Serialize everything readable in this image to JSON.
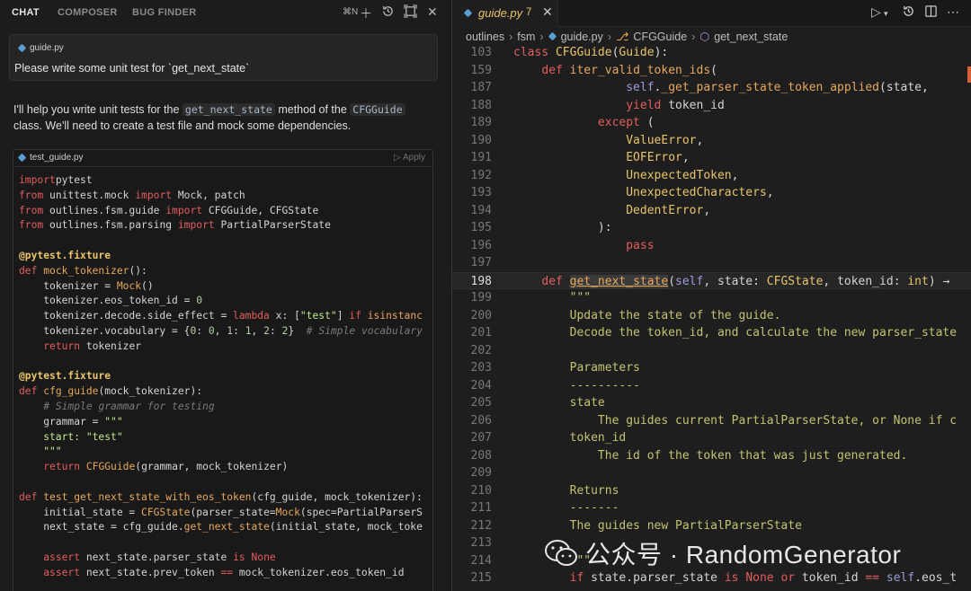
{
  "chat": {
    "tabs": [
      "CHAT",
      "COMPOSER",
      "BUG FINDER"
    ],
    "shortcut": "⌘N",
    "question": {
      "file_pill": "guide.py",
      "text": "Please write some unit test for `get_next_state`"
    },
    "answer": {
      "p1": "I'll help you write unit tests for the",
      "code1": "get_next_state",
      "p2": "method of the",
      "code2": "CFGGuide",
      "p3": "class. We'll need to create a test file and mock some dependencies."
    },
    "code_block": {
      "filename": "test_guide.py",
      "apply_label": "Apply"
    },
    "code_lines": [
      [
        [
          "k-red",
          "import"
        ],
        [
          "",
          "pytest"
        ]
      ],
      [
        [
          "k-red",
          "from"
        ],
        [
          "",
          " unittest.mock "
        ],
        [
          "k-red",
          "import"
        ],
        [
          "",
          " Mock, patch"
        ]
      ],
      [
        [
          "k-red",
          "from"
        ],
        [
          "",
          " outlines.fsm.guide "
        ],
        [
          "k-red",
          "import"
        ],
        [
          "",
          " CFGGuide, CFGState"
        ]
      ],
      [
        [
          "k-red",
          "from"
        ],
        [
          "",
          " outlines.fsm.parsing "
        ],
        [
          "k-red",
          "import"
        ],
        [
          "",
          " PartialParserState"
        ]
      ],
      [],
      [
        [
          "k-dec",
          "@pytest.fixture"
        ]
      ],
      [
        [
          "k-red",
          "def"
        ],
        [
          "",
          " "
        ],
        [
          "k-fn",
          "mock_tokenizer"
        ],
        [
          "",
          "():"
        ]
      ],
      [
        [
          "",
          "    tokenizer = "
        ],
        [
          "k-fn",
          "Mock"
        ],
        [
          "",
          "()"
        ]
      ],
      [
        [
          "",
          "    tokenizer.eos_token_id = "
        ],
        [
          "k-num",
          "0"
        ]
      ],
      [
        [
          "",
          "    tokenizer.decode.side_effect = "
        ],
        [
          "k-red",
          "lambda"
        ],
        [
          "",
          " x: ["
        ],
        [
          "k-str",
          "\"test\""
        ],
        [
          "",
          "] "
        ],
        [
          "k-red",
          "if"
        ],
        [
          "",
          " "
        ],
        [
          "k-fn",
          "isinstanc"
        ]
      ],
      [
        [
          "",
          "    tokenizer.vocabulary = {"
        ],
        [
          "k-num",
          "0"
        ],
        [
          "",
          ": "
        ],
        [
          "k-num",
          "0"
        ],
        [
          "",
          ", "
        ],
        [
          "k-num",
          "1"
        ],
        [
          "",
          ": "
        ],
        [
          "k-num",
          "1"
        ],
        [
          "",
          ", "
        ],
        [
          "k-num",
          "2"
        ],
        [
          "",
          ": "
        ],
        [
          "k-num",
          "2"
        ],
        [
          "",
          "}  "
        ],
        [
          "k-cm",
          "# Simple vocabulary"
        ]
      ],
      [
        [
          "",
          "    "
        ],
        [
          "k-red",
          "return"
        ],
        [
          "",
          " tokenizer"
        ]
      ],
      [],
      [
        [
          "k-dec",
          "@pytest.fixture"
        ]
      ],
      [
        [
          "k-red",
          "def"
        ],
        [
          "",
          " "
        ],
        [
          "k-fn",
          "cfg_guide"
        ],
        [
          "",
          "(mock_tokenizer):"
        ]
      ],
      [
        [
          "",
          "    "
        ],
        [
          "k-cm",
          "# Simple grammar for testing"
        ]
      ],
      [
        [
          "",
          "    grammar = "
        ],
        [
          "k-str",
          "\"\"\""
        ]
      ],
      [
        [
          "k-str",
          "    start: \"test\""
        ]
      ],
      [
        [
          "k-str",
          "    \"\"\""
        ]
      ],
      [
        [
          "",
          "    "
        ],
        [
          "k-red",
          "return"
        ],
        [
          "",
          " "
        ],
        [
          "k-fn",
          "CFGGuide"
        ],
        [
          "",
          "(grammar, mock_tokenizer)"
        ]
      ],
      [],
      [
        [
          "k-red",
          "def"
        ],
        [
          "",
          " "
        ],
        [
          "k-fn",
          "test_get_next_state_with_eos_token"
        ],
        [
          "",
          "(cfg_guide, mock_tokenizer):"
        ]
      ],
      [
        [
          "",
          "    initial_state = "
        ],
        [
          "k-fn",
          "CFGState"
        ],
        [
          "",
          "(parser_state="
        ],
        [
          "k-fn",
          "Mock"
        ],
        [
          "",
          "(spec=PartialParserS"
        ]
      ],
      [
        [
          "",
          "    next_state = cfg_guide."
        ],
        [
          "k-fn",
          "get_next_state"
        ],
        [
          "",
          "(initial_state, mock_toke"
        ]
      ],
      [],
      [
        [
          "",
          "    "
        ],
        [
          "k-red",
          "assert"
        ],
        [
          "",
          " next_state.parser_state "
        ],
        [
          "k-red",
          "is"
        ],
        [
          "",
          " "
        ],
        [
          "k-red",
          "None"
        ]
      ],
      [
        [
          "",
          "    "
        ],
        [
          "k-red",
          "assert"
        ],
        [
          "",
          " next_state.prev_token "
        ],
        [
          "k-red",
          "=="
        ],
        [
          "",
          " mock_tokenizer.eos_token_id"
        ]
      ]
    ]
  },
  "editor": {
    "tab": {
      "filename": "guide.py",
      "badge": "7"
    },
    "breadcrumbs": [
      "outlines",
      "fsm",
      "guide.py",
      "CFGGuide",
      "get_next_state"
    ],
    "lines": [
      {
        "n": "103",
        "t": [
          [
            "k-red",
            "class"
          ],
          [
            "",
            " "
          ],
          [
            "k-cls",
            "CFGGuide"
          ],
          [
            "",
            "("
          ],
          [
            "k-cls",
            "Guide"
          ],
          [
            "",
            "):"
          ]
        ]
      },
      {
        "n": "159",
        "t": [
          [
            "",
            "    "
          ],
          [
            "k-red",
            "def"
          ],
          [
            "",
            " "
          ],
          [
            "k-fn",
            "iter_valid_token_ids"
          ],
          [
            "",
            "("
          ]
        ]
      },
      {
        "n": "187",
        "t": [
          [
            "",
            "                "
          ],
          [
            "k-self",
            "self"
          ],
          [
            "",
            "."
          ],
          [
            "k-fn",
            "_get_parser_state_token_applied"
          ],
          [
            "",
            "(state, "
          ]
        ]
      },
      {
        "n": "188",
        "t": [
          [
            "",
            "                "
          ],
          [
            "k-red",
            "yield"
          ],
          [
            "",
            " token_id"
          ]
        ]
      },
      {
        "n": "189",
        "t": [
          [
            "",
            "            "
          ],
          [
            "k-red",
            "except"
          ],
          [
            "",
            " ("
          ]
        ]
      },
      {
        "n": "190",
        "t": [
          [
            "",
            "                "
          ],
          [
            "k-cls",
            "ValueError"
          ],
          [
            "",
            ","
          ]
        ]
      },
      {
        "n": "191",
        "t": [
          [
            "",
            "                "
          ],
          [
            "k-cls",
            "EOFError"
          ],
          [
            "",
            ","
          ]
        ]
      },
      {
        "n": "192",
        "t": [
          [
            "",
            "                "
          ],
          [
            "k-cls",
            "UnexpectedToken"
          ],
          [
            "",
            ","
          ]
        ]
      },
      {
        "n": "193",
        "t": [
          [
            "",
            "                "
          ],
          [
            "k-cls",
            "UnexpectedCharacters"
          ],
          [
            "",
            ","
          ]
        ]
      },
      {
        "n": "194",
        "t": [
          [
            "",
            "                "
          ],
          [
            "k-cls",
            "DedentError"
          ],
          [
            "",
            ","
          ]
        ]
      },
      {
        "n": "195",
        "t": [
          [
            "",
            "            ):"
          ]
        ]
      },
      {
        "n": "196",
        "t": [
          [
            "",
            "                "
          ],
          [
            "k-red",
            "pass"
          ]
        ]
      },
      {
        "n": "197",
        "t": []
      },
      {
        "n": "198",
        "cur": true,
        "t": [
          [
            "",
            "    "
          ],
          [
            "k-red",
            "def"
          ],
          [
            "",
            " "
          ],
          [
            "k-fn k-hl",
            "get_next_state"
          ],
          [
            "",
            "("
          ],
          [
            "k-self",
            "self"
          ],
          [
            "",
            ", state: "
          ],
          [
            "k-cls",
            "CFGState"
          ],
          [
            "",
            ", token_id: "
          ],
          [
            "k-cls",
            "int"
          ],
          [
            "",
            ") →"
          ]
        ]
      },
      {
        "n": "199",
        "t": [
          [
            "k-doc",
            "        \"\"\""
          ]
        ]
      },
      {
        "n": "200",
        "t": [
          [
            "k-doc",
            "        Update the state of the guide."
          ]
        ]
      },
      {
        "n": "201",
        "t": [
          [
            "k-doc",
            "        Decode the token_id, and calculate the new parser_state"
          ]
        ]
      },
      {
        "n": "202",
        "t": []
      },
      {
        "n": "203",
        "t": [
          [
            "k-doc",
            "        Parameters"
          ]
        ]
      },
      {
        "n": "204",
        "t": [
          [
            "k-doc",
            "        ----------"
          ]
        ]
      },
      {
        "n": "205",
        "t": [
          [
            "k-doc",
            "        state"
          ]
        ]
      },
      {
        "n": "206",
        "t": [
          [
            "k-doc",
            "            The guides current PartialParserState, or None if c"
          ]
        ]
      },
      {
        "n": "207",
        "t": [
          [
            "k-doc",
            "        token_id"
          ]
        ]
      },
      {
        "n": "208",
        "t": [
          [
            "k-doc",
            "            The id of the token that was just generated."
          ]
        ]
      },
      {
        "n": "209",
        "t": []
      },
      {
        "n": "210",
        "t": [
          [
            "k-doc",
            "        Returns"
          ]
        ]
      },
      {
        "n": "211",
        "t": [
          [
            "k-doc",
            "        -------"
          ]
        ]
      },
      {
        "n": "212",
        "t": [
          [
            "k-doc",
            "        The guides new PartialParserState"
          ]
        ]
      },
      {
        "n": "213",
        "t": []
      },
      {
        "n": "214",
        "t": [
          [
            "k-doc",
            "        \"\"\""
          ]
        ]
      },
      {
        "n": "215",
        "t": [
          [
            "",
            "        "
          ],
          [
            "k-red",
            "if"
          ],
          [
            "",
            " state.parser_state "
          ],
          [
            "k-red",
            "is"
          ],
          [
            "",
            " "
          ],
          [
            "k-red",
            "None"
          ],
          [
            "",
            " "
          ],
          [
            "k-red",
            "or"
          ],
          [
            "",
            " token_id "
          ],
          [
            "k-red",
            "=="
          ],
          [
            "",
            " "
          ],
          [
            "k-self",
            "self"
          ],
          [
            "",
            ".eos_t"
          ]
        ]
      }
    ]
  },
  "watermark": {
    "text": "公众号 · RandomGenerator"
  }
}
